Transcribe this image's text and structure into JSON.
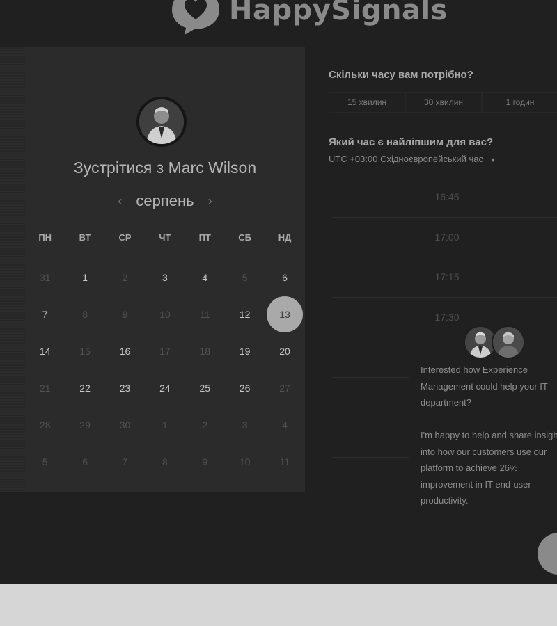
{
  "brand": {
    "name": "HappySignals"
  },
  "calendar": {
    "title": "Зустрітися з Marc Wilson",
    "month": "серпень",
    "weekdays": [
      "ПН",
      "ВТ",
      "СР",
      "ЧТ",
      "ПТ",
      "СБ",
      "НД"
    ],
    "weeks": [
      [
        {
          "d": "31",
          "a": false
        },
        {
          "d": "1",
          "a": true
        },
        {
          "d": "2",
          "a": false
        },
        {
          "d": "3",
          "a": true
        },
        {
          "d": "4",
          "a": true
        },
        {
          "d": "5",
          "a": false
        },
        {
          "d": "6",
          "a": true
        }
      ],
      [
        {
          "d": "7",
          "a": true
        },
        {
          "d": "8",
          "a": false
        },
        {
          "d": "9",
          "a": false
        },
        {
          "d": "10",
          "a": false
        },
        {
          "d": "11",
          "a": false
        },
        {
          "d": "12",
          "a": true
        },
        {
          "d": "13",
          "a": true,
          "sel": true
        }
      ],
      [
        {
          "d": "14",
          "a": true
        },
        {
          "d": "15",
          "a": false
        },
        {
          "d": "16",
          "a": true
        },
        {
          "d": "17",
          "a": false
        },
        {
          "d": "18",
          "a": false
        },
        {
          "d": "19",
          "a": true
        },
        {
          "d": "20",
          "a": true
        }
      ],
      [
        {
          "d": "21",
          "a": false
        },
        {
          "d": "22",
          "a": true
        },
        {
          "d": "23",
          "a": true
        },
        {
          "d": "24",
          "a": true
        },
        {
          "d": "25",
          "a": true
        },
        {
          "d": "26",
          "a": true
        },
        {
          "d": "27",
          "a": false
        }
      ],
      [
        {
          "d": "28",
          "a": false
        },
        {
          "d": "29",
          "a": false
        },
        {
          "d": "30",
          "a": false
        },
        {
          "d": "1",
          "a": false
        },
        {
          "d": "2",
          "a": false
        },
        {
          "d": "3",
          "a": false
        },
        {
          "d": "4",
          "a": false
        }
      ],
      [
        {
          "d": "5",
          "a": false
        },
        {
          "d": "6",
          "a": false
        },
        {
          "d": "7",
          "a": false
        },
        {
          "d": "8",
          "a": false
        },
        {
          "d": "9",
          "a": false
        },
        {
          "d": "10",
          "a": false
        },
        {
          "d": "11",
          "a": false
        }
      ]
    ]
  },
  "booking": {
    "duration_question": "Скільки часу вам потрібно?",
    "durations": [
      "15 хвилин",
      "30 хвилин",
      "1 годин"
    ],
    "time_question": "Який час є найліпшим для вас?",
    "timezone": "UTC +03:00 Східноєвропейський час",
    "slots": [
      "16:45",
      "17:00",
      "17:15",
      "17:30"
    ]
  },
  "chat": {
    "message_1": "Interested how Experience Management could help your IT department?",
    "message_2": "I'm happy to help and share insight into how our customers use our platform to achieve 26% improvement in IT end-user productivity."
  },
  "icons": {
    "prev": "chevron-left-icon",
    "next": "chevron-right-icon",
    "tz_dropdown": "caret-down-icon",
    "logo": "speech-heart-icon",
    "chat": "chat-bubble-icon"
  }
}
